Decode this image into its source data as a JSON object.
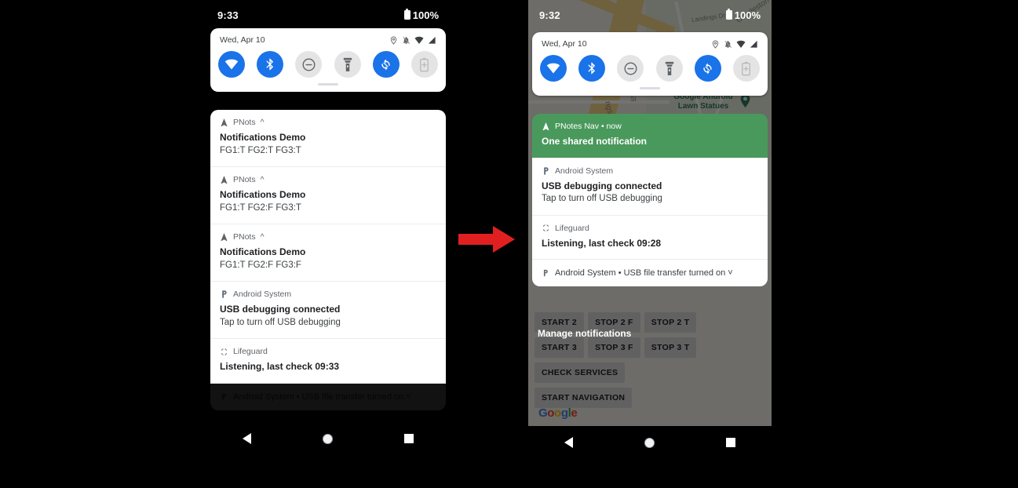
{
  "left_phone": {
    "status_bar": {
      "clock": "9:33",
      "battery": "100%",
      "battery_icon": "battery-full-icon"
    },
    "quick_settings": {
      "date": "Wed, Apr 10",
      "status_icons": [
        "location-pin-icon",
        "vibrate-off-icon",
        "wifi-icon",
        "signal-bars-icon"
      ],
      "tiles": [
        {
          "name": "wifi-tile",
          "icon": "wifi-icon",
          "state": "on"
        },
        {
          "name": "bluetooth-tile",
          "icon": "bluetooth-icon",
          "state": "on"
        },
        {
          "name": "do-not-disturb-tile",
          "icon": "do-not-disturb-icon",
          "state": "off"
        },
        {
          "name": "flashlight-tile",
          "icon": "flashlight-icon",
          "state": "off"
        },
        {
          "name": "auto-rotate-tile",
          "icon": "auto-rotate-icon",
          "state": "on"
        },
        {
          "name": "battery-saver-tile",
          "icon": "battery-saver-icon",
          "state": "off"
        }
      ]
    },
    "notifications": [
      {
        "app": "PNots",
        "expander": "^",
        "icon": "navigation-arrow-icon",
        "title": "Notifications Demo",
        "text": "FG1:T FG2:T FG3:T",
        "style": "plain"
      },
      {
        "app": "PNots",
        "expander": "^",
        "icon": "navigation-arrow-icon",
        "title": "Notifications Demo",
        "text": "FG1:T FG2:F FG3:T",
        "style": "plain"
      },
      {
        "app": "PNots",
        "expander": "^",
        "icon": "navigation-arrow-icon",
        "title": "Notifications Demo",
        "text": "FG1:T FG2:F FG3:F",
        "style": "plain"
      },
      {
        "app": "Android System",
        "expander": "",
        "icon": "android-system-p-icon",
        "title": "USB debugging connected",
        "text": "Tap to turn off USB debugging",
        "style": "plain"
      },
      {
        "app": "Lifeguard",
        "expander": "",
        "icon": "lifeguard-ring-icon",
        "title": "Listening, last check 09:33",
        "text": "",
        "style": "plain"
      }
    ],
    "summary_row": {
      "icon": "android-system-p-icon",
      "text": "Android System • USB file transfer turned on",
      "chevron": "˅",
      "faded": true
    }
  },
  "right_phone": {
    "status_bar": {
      "clock": "9:32",
      "battery": "100%",
      "battery_icon": "battery-full-icon"
    },
    "quick_settings": {
      "date": "Wed, Apr 10",
      "status_icons": [
        "location-pin-icon",
        "vibrate-off-icon",
        "wifi-icon",
        "signal-bars-icon"
      ],
      "tiles": [
        {
          "name": "wifi-tile",
          "icon": "wifi-icon",
          "state": "on"
        },
        {
          "name": "bluetooth-tile",
          "icon": "bluetooth-icon",
          "state": "on"
        },
        {
          "name": "do-not-disturb-tile",
          "icon": "do-not-disturb-icon",
          "state": "off"
        },
        {
          "name": "flashlight-tile",
          "icon": "flashlight-icon",
          "state": "off"
        },
        {
          "name": "auto-rotate-tile",
          "icon": "auto-rotate-icon",
          "state": "on"
        },
        {
          "name": "battery-saver-tile",
          "icon": "battery-saver-icon",
          "state": "off"
        }
      ]
    },
    "notifications": [
      {
        "app": "PNotes Nav • now",
        "expander": "",
        "icon": "navigation-arrow-icon",
        "title": "One shared notification",
        "text": "",
        "style": "green"
      },
      {
        "app": "Android System",
        "expander": "",
        "icon": "android-system-p-icon",
        "title": "USB debugging connected",
        "text": "Tap to turn off USB debugging",
        "style": "plain"
      },
      {
        "app": "Lifeguard",
        "expander": "",
        "icon": "lifeguard-ring-icon",
        "title": "Listening, last check 09:28",
        "text": "",
        "style": "plain"
      }
    ],
    "summary_row": {
      "icon": "android-system-p-icon",
      "text": "Android System • USB file transfer turned on",
      "chevron": "˅",
      "faded": false
    },
    "manage_notifications_label": "Manage notifications",
    "app_background": {
      "buttons": [
        [
          "START 2",
          "STOP 2 F",
          "STOP 2 T"
        ],
        [
          "START 3",
          "STOP 3 F",
          "STOP 3 T"
        ],
        [
          "CHECK SERVICES"
        ],
        [
          "START NAVIGATION"
        ]
      ],
      "map_labels": [
        "Landings Dr",
        "Charleston",
        "St",
        "ngstorff"
      ],
      "map_poi": "Google Android\nLawn Statues",
      "map_poi_line1": "Google Android",
      "map_poi_line2": "Lawn Statues",
      "logo_letters": [
        "G",
        "o",
        "o",
        "g",
        "l",
        "e"
      ]
    }
  },
  "arrow": {
    "name": "right-arrow-annotation",
    "color": "#e02020",
    "direction": "right"
  },
  "colors": {
    "accent_blue": "#1a73e8",
    "shared_notification_green": "#4a995c",
    "background": "#000000",
    "card_white": "#ffffff"
  },
  "navbar": {
    "back": "back-triangle-icon",
    "home": "home-circle-icon",
    "recents": "recents-square-icon"
  }
}
